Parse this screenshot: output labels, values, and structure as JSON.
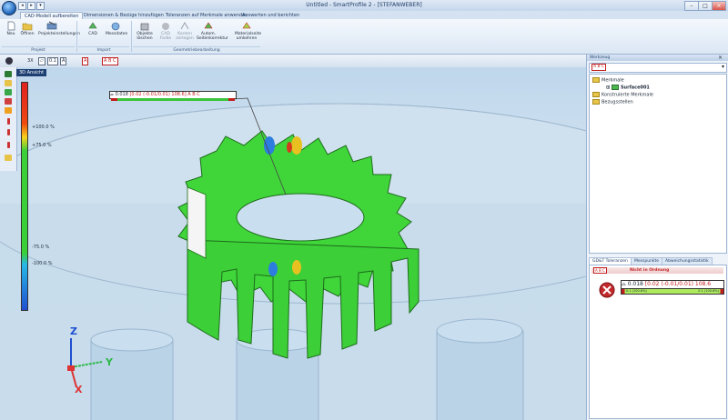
{
  "window": {
    "title": "Untitled - SmartProfile 2 - [STEFANWEBER]",
    "minimize": "–",
    "maximize": "□",
    "close": "×"
  },
  "quick_access": [
    "◂",
    "▸",
    "▾"
  ],
  "tabs": [
    {
      "label": "CAD-Modell aufbereiten",
      "active": true
    },
    {
      "label": "Dimensionen & Bezüge hinzufügen",
      "active": false
    },
    {
      "label": "Toleranzen auf Merkmale anwenden",
      "active": false
    },
    {
      "label": "Auswerten und berichten",
      "active": false
    }
  ],
  "tab_keys": [
    "S",
    "T",
    "R"
  ],
  "ribbon": {
    "buttons": [
      {
        "label": "Neu",
        "icon": "new-file-icon"
      },
      {
        "label": "Öffnen",
        "icon": "open-folder-icon"
      },
      {
        "label": "Projekteinstellungen",
        "icon": "project-settings-icon"
      },
      {
        "label": "CAD",
        "icon": "cad-import-icon"
      },
      {
        "label": "Messdaten",
        "icon": "measurement-data-icon"
      },
      {
        "label": "Objekte löschen",
        "icon": "delete-objects-icon"
      },
      {
        "label": "CAD Farbe",
        "icon": "cad-color-icon",
        "disabled": true
      },
      {
        "label": "Kanten zerlegen",
        "icon": "split-edges-icon",
        "disabled": true
      },
      {
        "label": "Autom. Seitenkorrektur",
        "icon": "auto-side-correction-icon"
      },
      {
        "label": "Materialseite umkehren",
        "icon": "flip-material-side-icon"
      }
    ],
    "groups": [
      "Projekt",
      "Import",
      "Geometriebearbeitung"
    ]
  },
  "toolbar": {
    "scale_label": "3X",
    "box1": "0.1",
    "box2": "A",
    "box3": "A",
    "box4": "A B C"
  },
  "viewport": {
    "view_label": "3D Ansicht",
    "scale_labels": [
      "+100.0 %",
      "+75.0 %",
      "-75.0 %",
      "-100.0 %"
    ],
    "fcf_label": {
      "value": "0.018",
      "tol": "[0.02 (-0.01/0.01) 108.6]",
      "datums": "A",
      "datums2": "B C"
    },
    "axis": {
      "x": "X",
      "y": "Y",
      "z": "Z"
    }
  },
  "right_panel": {
    "header": "Werkzeug",
    "filter": "A B C",
    "tree": [
      {
        "label": "Merkmale",
        "level": 0
      },
      {
        "label": "Surface001",
        "level": 1
      },
      {
        "label": "Konstruierte Merkmale",
        "level": 0
      },
      {
        "label": "Bezugsstellen",
        "level": 0
      }
    ],
    "lower_tabs": [
      "GD&T Toleranzen",
      "Messpunkte",
      "Abweichungsstatistik"
    ],
    "status": "Nicht in Ordnung",
    "datum_ref": "A B C",
    "fcf": {
      "value": "0.018",
      "tol": "[0.02 (-0.01/0.01) 108.6",
      "bar_left": "0.1 (100.6%)",
      "bar_right": "0.1 (100.6%)"
    }
  },
  "colors": {
    "accent": "#1e3f72",
    "fail": "#c2292b",
    "gear": "#3fd33c"
  }
}
